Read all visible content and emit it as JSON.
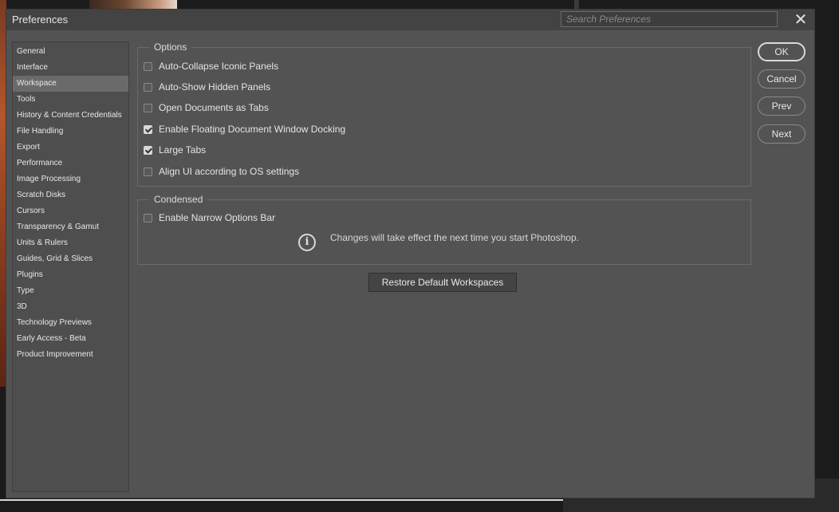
{
  "dialog": {
    "title": "Preferences",
    "search_placeholder": "Search Preferences",
    "close_glyph": "✕"
  },
  "sidebar": {
    "selected_index": 2,
    "items": [
      {
        "label": "General"
      },
      {
        "label": "Interface"
      },
      {
        "label": "Workspace"
      },
      {
        "label": "Tools"
      },
      {
        "label": "History & Content Credentials"
      },
      {
        "label": "File Handling"
      },
      {
        "label": "Export"
      },
      {
        "label": "Performance"
      },
      {
        "label": "Image Processing"
      },
      {
        "label": "Scratch Disks"
      },
      {
        "label": "Cursors"
      },
      {
        "label": "Transparency & Gamut"
      },
      {
        "label": "Units & Rulers"
      },
      {
        "label": "Guides, Grid & Slices"
      },
      {
        "label": "Plugins"
      },
      {
        "label": "Type"
      },
      {
        "label": "3D"
      },
      {
        "label": "Technology Previews"
      },
      {
        "label": "Early Access - Beta"
      },
      {
        "label": "Product Improvement"
      }
    ]
  },
  "options": {
    "legend": "Options",
    "items": [
      {
        "label": "Auto-Collapse Iconic Panels",
        "checked": false
      },
      {
        "label": "Auto-Show Hidden Panels",
        "checked": false
      },
      {
        "label": "Open Documents as Tabs",
        "checked": false
      },
      {
        "label": "Enable Floating Document Window Docking",
        "checked": true
      },
      {
        "label": "Large Tabs",
        "checked": true
      },
      {
        "label": "Align UI according to OS settings",
        "checked": false
      }
    ]
  },
  "condensed": {
    "legend": "Condensed",
    "items": [
      {
        "label": "Enable Narrow Options Bar",
        "checked": false
      }
    ],
    "info_icon": "info-icon",
    "info_text": "Changes will take effect the next time you start Photoshop."
  },
  "buttons": {
    "restore": "Restore Default Workspaces",
    "ok": "OK",
    "cancel": "Cancel",
    "prev": "Prev",
    "next": "Next"
  },
  "colors": {
    "dialog_bg": "#535353",
    "titlebar_bg": "#434343",
    "selected_item_bg": "#6a6a6a"
  }
}
